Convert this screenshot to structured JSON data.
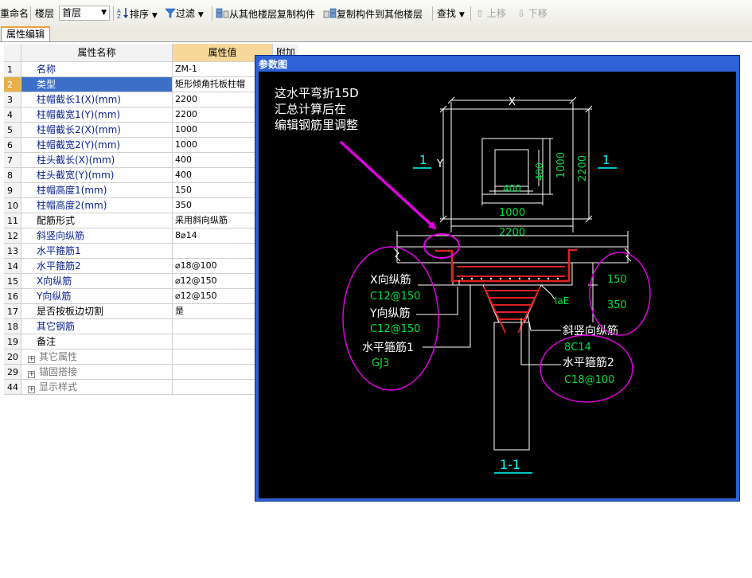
{
  "toolbar": {
    "rename": "重命名",
    "floor_label": "楼层",
    "floor_value": "首层",
    "sort": "排序",
    "filter": "过滤",
    "copy_from": "从其他楼层复制构件",
    "copy_to": "复制构件到其他楼层",
    "find": "查找",
    "move_up": "上移",
    "move_down": "下移"
  },
  "tab": "属性编辑",
  "grid": {
    "header": {
      "name": "属性名称",
      "value": "属性值",
      "extra": "附加"
    },
    "rows": [
      {
        "n": "1",
        "name": "名称",
        "value": "ZM-1"
      },
      {
        "n": "2",
        "name": "类型",
        "value": "矩形倾角托板柱帽"
      },
      {
        "n": "3",
        "name": "柱帽截长1(X)(mm)",
        "value": "2200"
      },
      {
        "n": "4",
        "name": "柱帽截宽1(Y)(mm)",
        "value": "2200"
      },
      {
        "n": "5",
        "name": "柱帽截长2(X)(mm)",
        "value": "1000"
      },
      {
        "n": "6",
        "name": "柱帽截宽2(Y)(mm)",
        "value": "1000"
      },
      {
        "n": "7",
        "name": "柱头截长(X)(mm)",
        "value": "400"
      },
      {
        "n": "8",
        "name": "柱头截宽(Y)(mm)",
        "value": "400"
      },
      {
        "n": "9",
        "name": "柱帽高度1(mm)",
        "value": "150"
      },
      {
        "n": "10",
        "name": "柱帽高度2(mm)",
        "value": "350"
      },
      {
        "n": "11",
        "name": "配筋形式",
        "value": "采用斜向纵筋"
      },
      {
        "n": "12",
        "name": "斜竖向纵筋",
        "value": "8⌀14"
      },
      {
        "n": "13",
        "name": "水平箍筋1",
        "value": ""
      },
      {
        "n": "14",
        "name": "水平箍筋2",
        "value": "⌀18@100"
      },
      {
        "n": "15",
        "name": "X向纵筋",
        "value": "⌀12@150"
      },
      {
        "n": "16",
        "name": "Y向纵筋",
        "value": "⌀12@150"
      },
      {
        "n": "17",
        "name": "是否按板边切割",
        "value": "是"
      },
      {
        "n": "18",
        "name": "其它钢筋",
        "value": ""
      },
      {
        "n": "19",
        "name": "备注",
        "value": ""
      },
      {
        "n": "20",
        "name": "其它属性",
        "value": ""
      },
      {
        "n": "29",
        "name": "锚固搭接",
        "value": ""
      },
      {
        "n": "44",
        "name": "显示样式",
        "value": ""
      }
    ]
  },
  "param_window": {
    "title": "参数图",
    "note_line1": "这水平弯折15D",
    "note_line2": "汇总计算后在",
    "note_line3": "编辑钢筋里调整",
    "dim_x": "X",
    "dim_y": "Y",
    "dim_2200_top": "2200",
    "dim_1000_right": "1000",
    "dim_400_right": "400",
    "dim_400_bottom": "400",
    "dim_1000_bottom": "1000",
    "dim_2200_bottom": "2200",
    "sec_left": "1",
    "sec_right": "1",
    "lbl_x_rebar": "X向纵筋",
    "val_x_rebar": "C12@150",
    "lbl_y_rebar": "Y向纵筋",
    "val_y_rebar": "C12@150",
    "lbl_hoop1": "水平箍筋1",
    "val_hoop1": "GJ3",
    "lbl_slant": "斜竖向纵筋",
    "val_slant": "8C14",
    "lbl_hoop2": "水平箍筋2",
    "val_hoop2": "C18@100",
    "dim_150": "150",
    "dim_350": "350",
    "lae": "laE",
    "section_label": "1-1",
    "colors": {
      "line": "#ffffff",
      "dim_text": "#00e040",
      "cyan": "#00ffff",
      "rebar": "#e02020",
      "annotation": "#e000e0",
      "title_bar": "#2e62d6"
    }
  }
}
